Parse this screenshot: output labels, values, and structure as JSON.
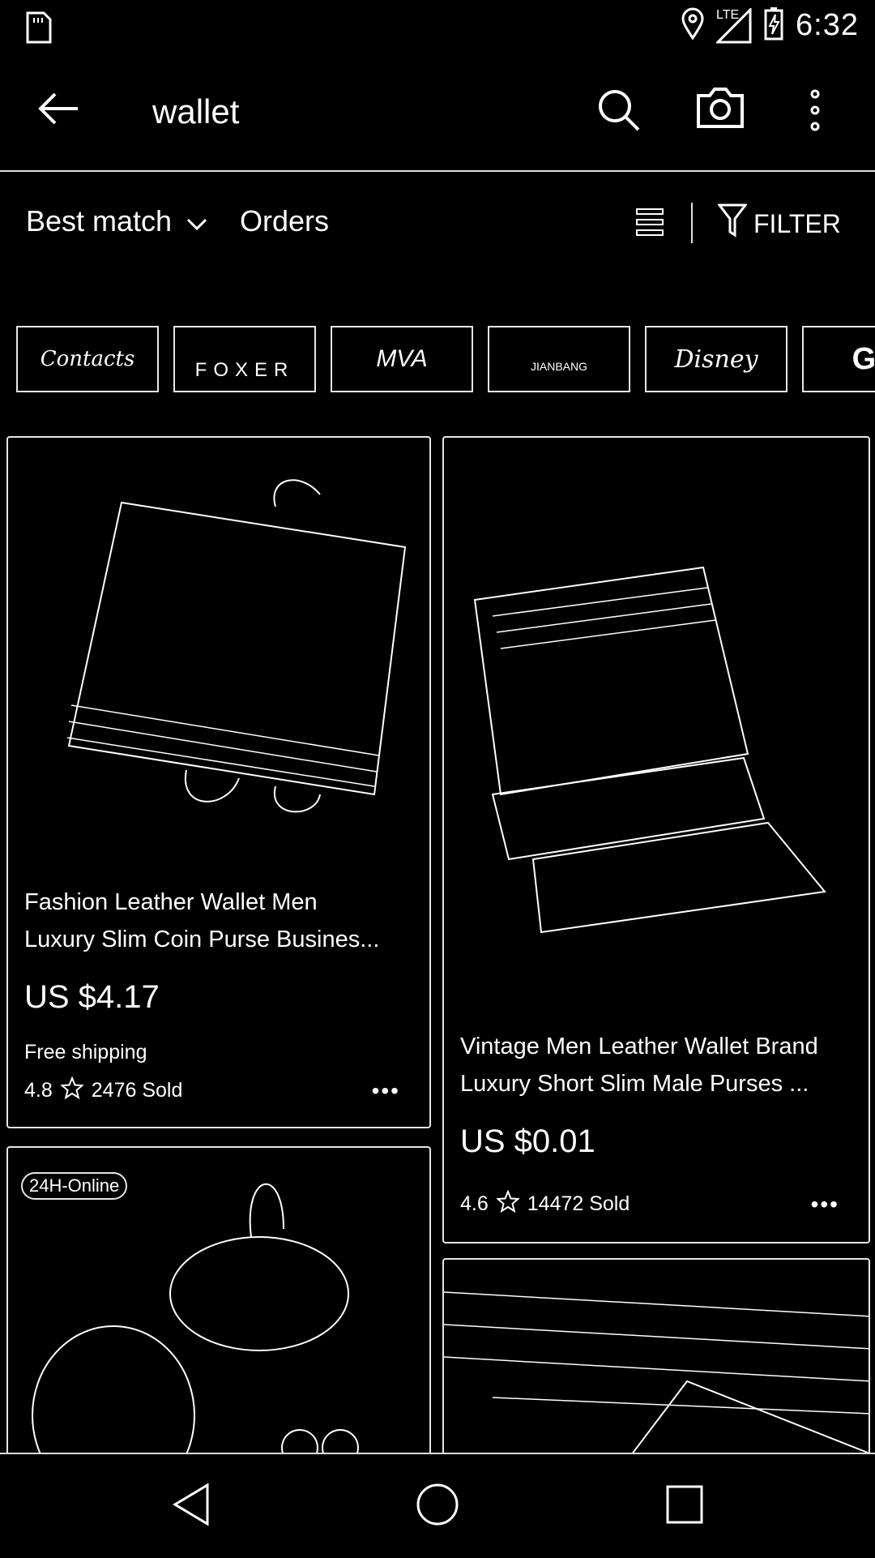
{
  "status_bar": {
    "time": "6:32",
    "network_label": "LTE",
    "icons": [
      "sd-card-icon",
      "location-icon",
      "lte-signal-icon",
      "battery-charging-icon"
    ]
  },
  "search": {
    "query": "wallet"
  },
  "sort_bar": {
    "best_match": "Best match",
    "orders": "Orders",
    "filter": "FILTER"
  },
  "brands": [
    {
      "label": "Contacts"
    },
    {
      "label": "FOXER"
    },
    {
      "label": "MVA"
    },
    {
      "label": "JIANBANG"
    },
    {
      "label": "Disney"
    },
    {
      "label": "GZ"
    }
  ],
  "products": [
    {
      "title": "Fashion Leather Wallet Men\nLuxury Slim Coin Purse Busines...",
      "price": "US $4.17",
      "shipping": "Free shipping",
      "rating": "4.8",
      "sold": "2476 Sold"
    },
    {
      "title": "Vintage Men Leather Wallet Brand\nLuxury Short Slim Male Purses ...",
      "price": "US $0.01",
      "rating": "4.6",
      "sold": "14472 Sold"
    },
    {
      "badge": "24H-Online"
    },
    {}
  ],
  "colors": {
    "background": "#000000",
    "outline": "#e6e6e6"
  }
}
